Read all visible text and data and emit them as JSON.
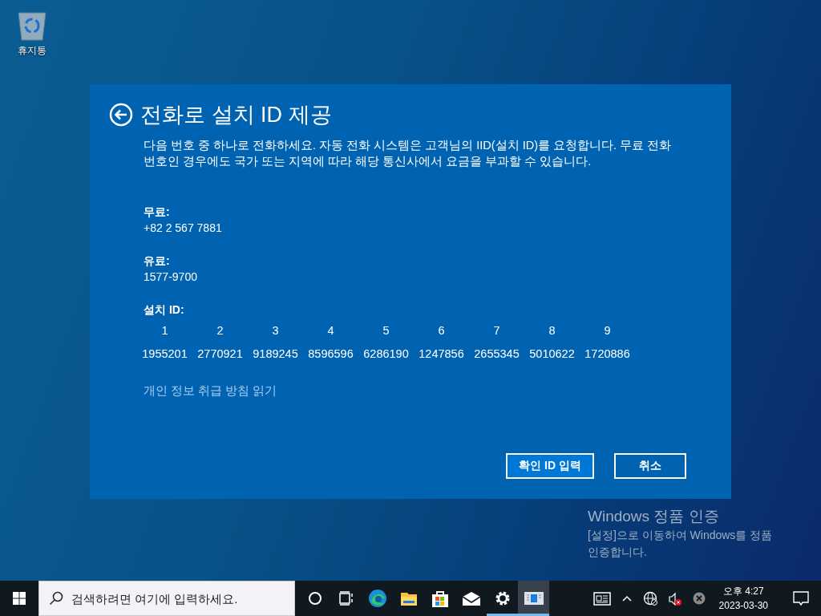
{
  "desktop_icons": [
    {
      "label": "휴지통"
    }
  ],
  "dialog": {
    "title": "전화로 설치 ID 제공",
    "description": "다음 번호 중 하나로 전화하세요. 자동 전화 시스템은 고객님의 IID(설치 ID)를 요청합니다. 무료 전화 번호인 경우에도 국가 또는 지역에 따라 해당 통신사에서 요금을 부과할 수 있습니다.",
    "sections": [
      {
        "label": "무료:",
        "value": "+82 2 567 7881"
      },
      {
        "label": "유료:",
        "value": "1577-9700"
      }
    ],
    "installation_id": {
      "label": "설치 ID:",
      "groups": [
        {
          "number": "1",
          "code": "1955201"
        },
        {
          "number": "2",
          "code": "2770921"
        },
        {
          "number": "3",
          "code": "9189245"
        },
        {
          "number": "4",
          "code": "8596596"
        },
        {
          "number": "5",
          "code": "6286190"
        },
        {
          "number": "6",
          "code": "1247856"
        },
        {
          "number": "7",
          "code": "2655345"
        },
        {
          "number": "8",
          "code": "5010622"
        },
        {
          "number": "9",
          "code": "1720886"
        }
      ]
    },
    "privacy_link": "개인 정보 취급 방침 읽기",
    "buttons": [
      {
        "label": "확인 ID 입력",
        "kind": "primary"
      },
      {
        "label": "취소",
        "kind": "secondary"
      }
    ]
  },
  "activation_notice": {
    "title": "Windows 정품 인증",
    "message": "[설정]으로 이동하여 Windows를 정품 인증합니다."
  },
  "taskbar": {
    "search": {
      "placeholder": "검색하려면 여기에 입력하세요."
    },
    "apps": [
      {
        "kind": "cortana",
        "running": false,
        "active": false
      },
      {
        "kind": "taskview",
        "running": false,
        "active": false
      },
      {
        "kind": "edge",
        "running": false,
        "active": false
      },
      {
        "kind": "explorer",
        "running": false,
        "active": false
      },
      {
        "kind": "store",
        "running": false,
        "active": false
      },
      {
        "kind": "mail",
        "running": false,
        "active": false
      },
      {
        "kind": "settings",
        "running": true,
        "active": false
      },
      {
        "kind": "window",
        "running": true,
        "active": true
      }
    ],
    "tray": [
      {
        "kind": "news"
      },
      {
        "kind": "chevron"
      },
      {
        "kind": "network"
      },
      {
        "kind": "volume-muted"
      },
      {
        "kind": "error"
      }
    ],
    "clock": {
      "time": "오후 4:27",
      "date": "2023-03-30"
    }
  }
}
